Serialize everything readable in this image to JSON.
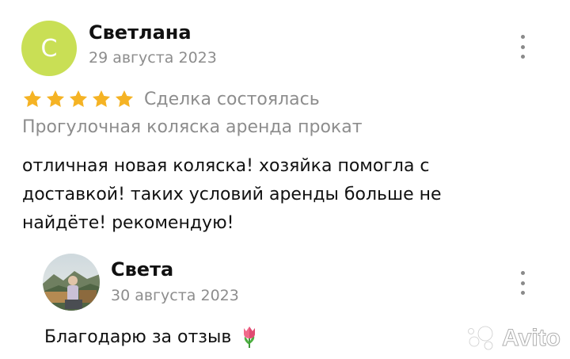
{
  "review": {
    "avatar_letter": "С",
    "avatar_color": "#c9df55",
    "author": "Светлана",
    "date": "29 августа 2023",
    "rating": 5,
    "rating_max": 5,
    "star_color": "#f5b324",
    "deal_status": "Сделка состоялась",
    "item_title": "Прогулочная коляска аренда прокат",
    "text": "отличная новая коляска! хозяйка помогла с доставкой! таких условий аренды больше не найдёте! рекомендую!",
    "menu_icon": "kebab-menu-icon"
  },
  "reply": {
    "author": "Света",
    "date": "30 августа 2023",
    "text": "Благодарю за отзыв",
    "emoji_icon": "tulip-icon",
    "menu_icon": "kebab-menu-icon"
  },
  "watermark": {
    "text": "Avito"
  }
}
